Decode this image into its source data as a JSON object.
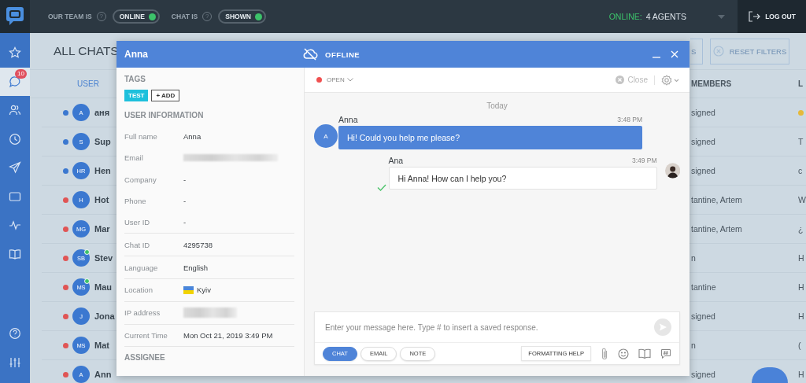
{
  "top_bar": {
    "team_label": "OUR TEAM IS",
    "team_help": "?",
    "chat_help": "?",
    "team_status": {
      "label": "ONLINE",
      "on": true
    },
    "chat_label": "CHAT IS",
    "chat_status": {
      "label": "SHOWN",
      "on": true
    },
    "agents_label": "ONLINE:",
    "agents_count": "4 AGENTS",
    "logout": "LOG OUT"
  },
  "sidebar": {
    "items": [
      {
        "kind": "star",
        "selected": false
      },
      {
        "kind": "chats",
        "selected": true,
        "badge": "10"
      },
      {
        "kind": "users",
        "selected": false
      },
      {
        "kind": "clock",
        "selected": false
      },
      {
        "kind": "send",
        "selected": false
      },
      {
        "kind": "window",
        "selected": false
      },
      {
        "kind": "activity",
        "selected": false
      },
      {
        "kind": "book",
        "selected": false
      }
    ],
    "bottom_items": [
      {
        "kind": "help",
        "selected": false
      },
      {
        "kind": "sliders",
        "selected": false
      }
    ]
  },
  "page": {
    "title": "ALL CHATS",
    "filter_button": "S",
    "reset_button": "RESET FILTERS",
    "columns": [
      "USER",
      "MEMBERS",
      "L"
    ],
    "rows": [
      {
        "color": "#3b78d0",
        "initials": "A",
        "online": false,
        "name": "аня",
        "members": "signed",
        "kind": "emoji"
      },
      {
        "color": "#3b78d0",
        "initials": "S",
        "online": false,
        "name": "Sup",
        "members": "signed",
        "kind": "text",
        "last": "T"
      },
      {
        "color": "#3b78d0",
        "initials": "HR",
        "online": false,
        "name": "Hen",
        "members": "signed",
        "kind": "text",
        "last": "c"
      },
      {
        "color": "#e05555",
        "initials": "H",
        "online": false,
        "name": "Hot",
        "members": "tantine, Artem",
        "kind": "text",
        "last": "W"
      },
      {
        "color": "#e05555",
        "initials": "MG",
        "online": false,
        "name": "Mar",
        "members": "tantine, Artem",
        "kind": "text",
        "last": "¿"
      },
      {
        "color": "#e05555",
        "initials": "SB",
        "online": true,
        "name": "Stev",
        "members": "n",
        "kind": "text",
        "last": "H"
      },
      {
        "color": "#e05555",
        "initials": "MS",
        "online": true,
        "name": "Mau",
        "members": "tantine",
        "kind": "text",
        "last": "H"
      },
      {
        "color": "#e05555",
        "initials": "J",
        "online": false,
        "name": "Jona",
        "members": "signed",
        "kind": "text",
        "last": "H"
      },
      {
        "color": "#e05555",
        "initials": "MS",
        "online": false,
        "name": "Mat",
        "members": "n",
        "kind": "text",
        "last": "("
      },
      {
        "color": "#e05555",
        "initials": "A",
        "online": false,
        "name": "Ann",
        "members": "signed",
        "kind": "text",
        "last": "H"
      }
    ]
  },
  "chat_window": {
    "visitor_name": "Anna",
    "connection": "OFFLINE",
    "tags_heading": "TAGS",
    "tags": [
      "TEST"
    ],
    "add_tag": "+ ADD",
    "info_heading": "USER INFORMATION",
    "info": [
      {
        "label": "Full name",
        "kind": "text",
        "value": "Anna"
      },
      {
        "label": "Email",
        "kind": "hidden"
      },
      {
        "label": "Company",
        "kind": "text",
        "value": "-"
      },
      {
        "label": "Phone",
        "kind": "text",
        "value": "-"
      },
      {
        "label": "User ID",
        "kind": "text",
        "value": "-"
      }
    ],
    "details": [
      {
        "label": "Chat ID",
        "kind": "text",
        "value": "4295738"
      },
      {
        "label": "Language",
        "kind": "text",
        "value": "English"
      },
      {
        "label": "Location",
        "kind": "location",
        "value": "Kyiv"
      },
      {
        "label": "IP address",
        "kind": "hidden"
      },
      {
        "label": "Current Time",
        "kind": "text",
        "value": "Mon Oct 21, 2019 3:49 PM"
      }
    ],
    "assignee_heading": "ASSIGNEE",
    "status": {
      "label": "OPEN"
    },
    "close_label": "Close",
    "date_label": "Today",
    "messages": [
      {
        "kind": "visitor",
        "initial": "A",
        "author": "Anna",
        "time": "3:48 PM",
        "text": "Hi! Could you help me please?"
      },
      {
        "kind": "agent",
        "author": "Ana",
        "time": "3:49 PM",
        "text": "Hi Anna! How can I help you?",
        "delivered": true
      }
    ],
    "composer": {
      "placeholder": "Enter your message here. Type # to insert a saved response.",
      "modes": [
        {
          "label": "CHAT",
          "selected": true
        },
        {
          "label": "EMAIL",
          "selected": false
        },
        {
          "label": "NOTE",
          "selected": false
        }
      ],
      "formatting_help": "FORMATTING HELP"
    }
  }
}
